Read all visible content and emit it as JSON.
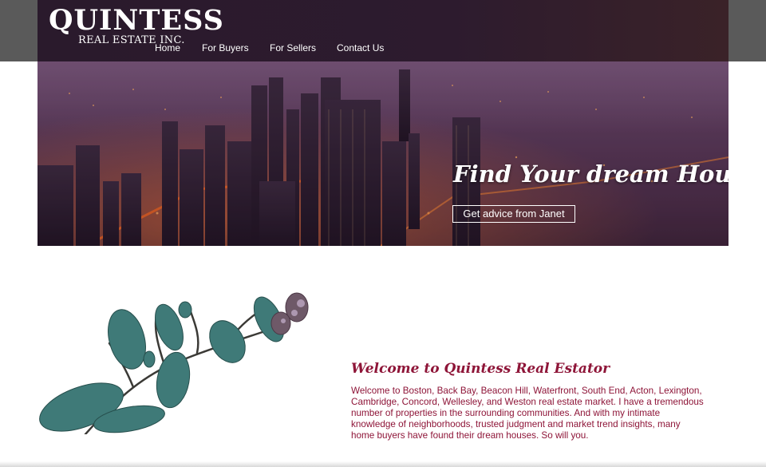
{
  "brand": {
    "name": "QUINTESS",
    "tagline": "REAL ESTATE INC."
  },
  "nav": {
    "items": [
      {
        "label": "Home"
      },
      {
        "label": "For Buyers"
      },
      {
        "label": "For Sellers"
      },
      {
        "label": "Contact Us"
      }
    ]
  },
  "hero": {
    "title": "Find Your dream House",
    "cta_label": "Get advice from Janet"
  },
  "welcome": {
    "title": "Welcome to Quintess Real Estator",
    "body": "Welcome to Boston, Back Bay, Beacon Hill, Waterfront, South End, Acton, Lexington, Cambridge, Concord, Wellesley, and Weston real estate market. I have a tremendous number of properties in the surrounding communities. And with my intimate knowledge of neighborhoods, trusted judgment and market trend insights, many home buyers have found their dream houses. So will you."
  },
  "colors": {
    "accent": "#8e1538",
    "header_bg": "#2d1b2e",
    "header_side": "#5a5a5a"
  }
}
